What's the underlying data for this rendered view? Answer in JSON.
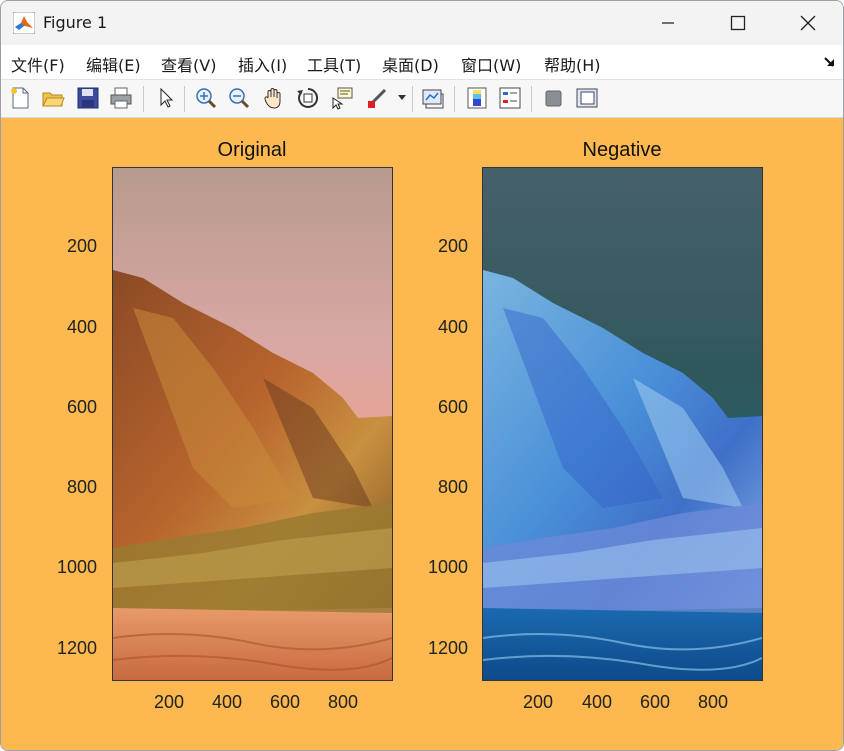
{
  "window": {
    "title": "Figure 1",
    "icons": [
      "matlab-icon",
      "minimize-icon",
      "maximize-icon",
      "close-icon"
    ]
  },
  "menubar": {
    "items": [
      "文件(F)",
      "编辑(E)",
      "查看(V)",
      "插入(I)",
      "工具(T)",
      "桌面(D)",
      "窗口(W)",
      "帮助(H)"
    ]
  },
  "toolbar": {
    "icons": [
      "new-figure-icon",
      "open-file-icon",
      "save-icon",
      "print-icon",
      "pointer-icon",
      "zoom-in-icon",
      "zoom-out-icon",
      "pan-icon",
      "rotate-3d-icon",
      "data-cursor-icon",
      "brush-icon",
      "link-plot-icon",
      "colorbar-icon",
      "legend-icon",
      "hide-plot-tools-icon",
      "show-plot-tools-icon"
    ]
  },
  "figure": {
    "background": "#fdb94f",
    "axes": [
      {
        "title": "Original",
        "yticks": [
          "200",
          "400",
          "600",
          "800",
          "1000",
          "1200"
        ],
        "xticks": [
          "200",
          "400",
          "600",
          "800"
        ]
      },
      {
        "title": "Negative",
        "yticks": [
          "200",
          "400",
          "600",
          "800",
          "1000",
          "1200"
        ],
        "xticks": [
          "200",
          "400",
          "600",
          "800"
        ]
      }
    ]
  }
}
